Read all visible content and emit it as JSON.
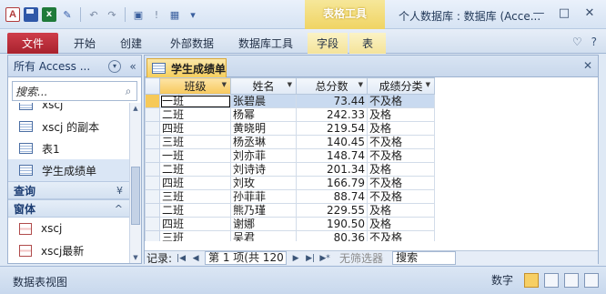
{
  "window": {
    "title": "个人数据库 : 数据库 (Acce...",
    "context_tool_label": "表格工具",
    "quick_access": [
      {
        "name": "access-app-icon",
        "glyph": "A"
      },
      {
        "name": "save-icon",
        "glyph": ""
      },
      {
        "name": "excel-icon",
        "glyph": "x"
      },
      {
        "name": "brush-icon",
        "glyph": "✎"
      },
      {
        "name": "undo-icon",
        "glyph": "↶"
      },
      {
        "name": "redo-icon",
        "glyph": "↷"
      },
      {
        "name": "run-icon",
        "glyph": "▣"
      },
      {
        "name": "exclaim-icon",
        "glyph": "!"
      },
      {
        "name": "grid-icon",
        "glyph": "▦"
      },
      {
        "name": "customize-icon",
        "glyph": "▾"
      }
    ],
    "controls": {
      "minimize": "—",
      "maximize": "□",
      "close": "✕"
    }
  },
  "ribbon": {
    "tabs": [
      "文件",
      "开始",
      "创建",
      "外部数据",
      "数据库工具",
      "字段",
      "表"
    ],
    "right_icons": {
      "collapse": "♡",
      "help": "?"
    }
  },
  "nav": {
    "title": "所有 Access ...",
    "dropdown_glyph": "▾",
    "collapse_glyph": "«",
    "search_placeholder": "搜索...",
    "search_icon": "⌕",
    "items_top": [
      {
        "label": "xscj",
        "icon": "table"
      },
      {
        "label": "xscj 的副本",
        "icon": "table"
      },
      {
        "label": "表1",
        "icon": "table"
      },
      {
        "label": "学生成绩单",
        "icon": "table",
        "selected": true
      }
    ],
    "groups": [
      {
        "label": "查询",
        "chevron": "¥",
        "items": []
      },
      {
        "label": "窗体",
        "chevron": "^",
        "items": [
          {
            "label": "xscj",
            "icon": "form"
          },
          {
            "label": "xscj最新",
            "icon": "form"
          }
        ]
      }
    ]
  },
  "document": {
    "tab_label": "学生成绩单",
    "close_glyph": "✕",
    "columns": [
      "班级",
      "姓名",
      "总分数",
      "成绩分类"
    ],
    "rows": [
      [
        "一班",
        "张碧晨",
        "73.44",
        "不及格"
      ],
      [
        "二班",
        "杨幂",
        "242.33",
        "及格"
      ],
      [
        "四班",
        "黄晓明",
        "219.54",
        "及格"
      ],
      [
        "三班",
        "杨丞琳",
        "140.45",
        "不及格"
      ],
      [
        "一班",
        "刘亦菲",
        "148.74",
        "不及格"
      ],
      [
        "二班",
        "刘诗诗",
        "201.34",
        "及格"
      ],
      [
        "四班",
        "刘玫",
        "166.79",
        "不及格"
      ],
      [
        "三班",
        "孙菲菲",
        "88.74",
        "不及格"
      ],
      [
        "二班",
        "熊乃瑾",
        "229.55",
        "及格"
      ],
      [
        "四班",
        "谢娜",
        "190.50",
        "及格"
      ],
      [
        "三班",
        "吴君",
        "80.36",
        "不及格"
      ]
    ],
    "record_nav": {
      "label": "记录:",
      "first": "|◀",
      "prev": "◀",
      "position": "第 1 项(共 120 项)",
      "next": "▶",
      "last": "▶|",
      "new": "▶*",
      "filter": "无筛选器",
      "search": "搜索"
    }
  },
  "status": {
    "left": "数据表视图",
    "mode": "数字"
  }
}
